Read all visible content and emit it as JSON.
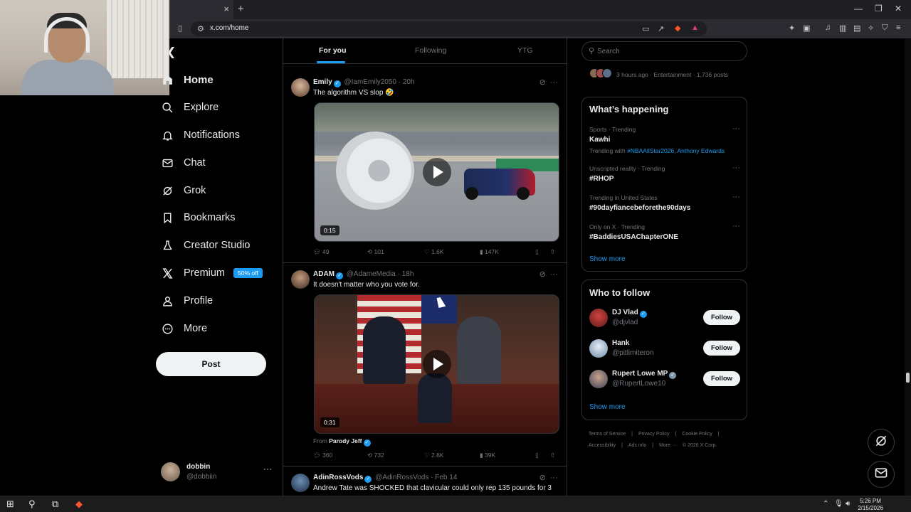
{
  "browser": {
    "url": "x.com/home",
    "tab_close": "×",
    "new_tab": "+"
  },
  "nav": {
    "items": [
      {
        "label": "Home",
        "icon": "home-icon"
      },
      {
        "label": "Explore",
        "icon": "search-icon"
      },
      {
        "label": "Notifications",
        "icon": "bell-icon"
      },
      {
        "label": "Chat",
        "icon": "mail-icon"
      },
      {
        "label": "Grok",
        "icon": "grok-icon"
      },
      {
        "label": "Bookmarks",
        "icon": "bookmark-icon"
      },
      {
        "label": "Creator Studio",
        "icon": "flask-icon"
      },
      {
        "label": "Premium",
        "icon": "x-logo-icon",
        "badge": "50% off"
      },
      {
        "label": "Profile",
        "icon": "person-icon"
      },
      {
        "label": "More",
        "icon": "more-circle-icon"
      }
    ],
    "post_label": "Post",
    "account": {
      "name": "dobbin",
      "handle": "@dobbiin",
      "more": "···"
    }
  },
  "timeline": {
    "tabs": [
      "For you",
      "Following",
      "YTG"
    ],
    "tweets": [
      {
        "name": "Emily",
        "handle": "@IamEmily2050",
        "time": "· 20h",
        "text": "The algorithm VS slop 🤣",
        "duration": "0:15",
        "replies": "49",
        "reposts": "101",
        "likes": "1.6K",
        "views": "147K"
      },
      {
        "name": "ADAM",
        "handle": "@AdameMedia",
        "time": "· 18h",
        "text": "It doesn't matter who you vote for.",
        "duration": "0:31",
        "from_prefix": "From",
        "from_name": "Parody Jeff",
        "replies": "360",
        "reposts": "732",
        "likes": "2.8K",
        "views": "39K"
      },
      {
        "name": "AdinRossVods",
        "handle": "@AdinRossVods",
        "time": "· Feb 14",
        "text": "Andrew Tate was SHOCKED that clavicular could only rep 135 pounds for 3"
      }
    ]
  },
  "search": {
    "placeholder": "Search"
  },
  "previous_trend": {
    "meta": "3 hours ago · Entertainment · 1,736 posts"
  },
  "whats_happening": {
    "title": "What’s happening",
    "trends": [
      {
        "context": "Sports · Trending",
        "name": "Kawhi",
        "sub_prefix": "Trending with",
        "sub_links": "#NBAAllStar2026, Anthony Edwards"
      },
      {
        "context": "Unscripted reality · Trending",
        "name": "#RHOP"
      },
      {
        "context": "Trending in United States",
        "name": "#90dayfiancebeforethe90days"
      },
      {
        "context": "Only on X · Trending",
        "name": "#BaddiesUSAChapterONE"
      }
    ],
    "show_more": "Show more"
  },
  "who_to_follow": {
    "title": "Who to follow",
    "accounts": [
      {
        "name": "DJ Vlad",
        "handle": "@djvlad",
        "button": "Follow"
      },
      {
        "name": "Hank",
        "handle": "@pitlimiteron",
        "button": "Follow"
      },
      {
        "name": "Rupert Lowe MP",
        "handle": "@RupertLowe10",
        "button": "Follow"
      }
    ],
    "show_more": "Show more"
  },
  "footer": [
    "Terms of Service",
    "|",
    "Privacy Policy",
    "|",
    "Cookie Policy",
    "|",
    "Accessibility",
    "|",
    "Ads info",
    "|",
    "More ···",
    "© 2026 X Corp."
  ],
  "taskbar": {
    "time": "5:26 PM",
    "date": "2/15/2026"
  },
  "colors": {
    "accent": "#1d9bf0",
    "background": "#000000",
    "text": "#e7e9ea",
    "muted": "#71767b"
  }
}
